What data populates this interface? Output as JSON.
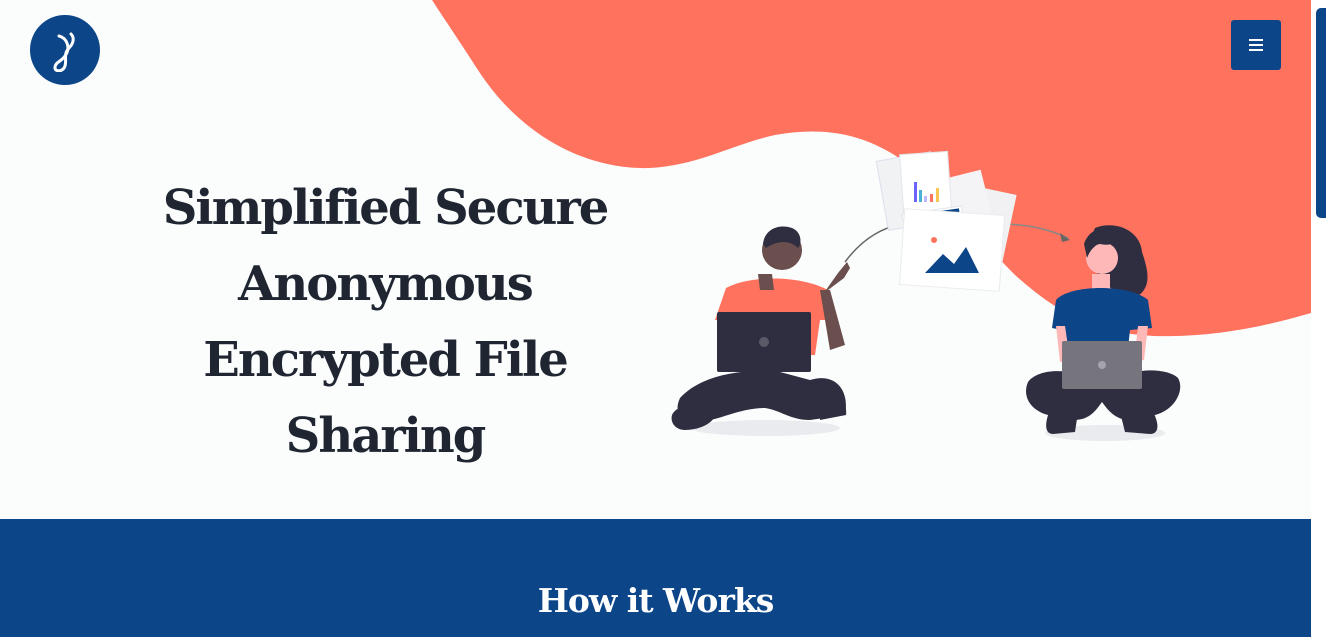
{
  "header": {
    "logo_icon": "ab-monogram-icon",
    "menu_icon": "hamburger-menu-icon"
  },
  "hero": {
    "title_lines": [
      "Simplified Secure",
      "Anonymous",
      "Encrypted File",
      "Sharing"
    ]
  },
  "how_it_works": {
    "title": "How it Works"
  },
  "colors": {
    "brand_blue": "#0d4589",
    "accent_coral": "#ff725e",
    "heading_dark": "#1f2632",
    "background": "#fbfcfc"
  }
}
